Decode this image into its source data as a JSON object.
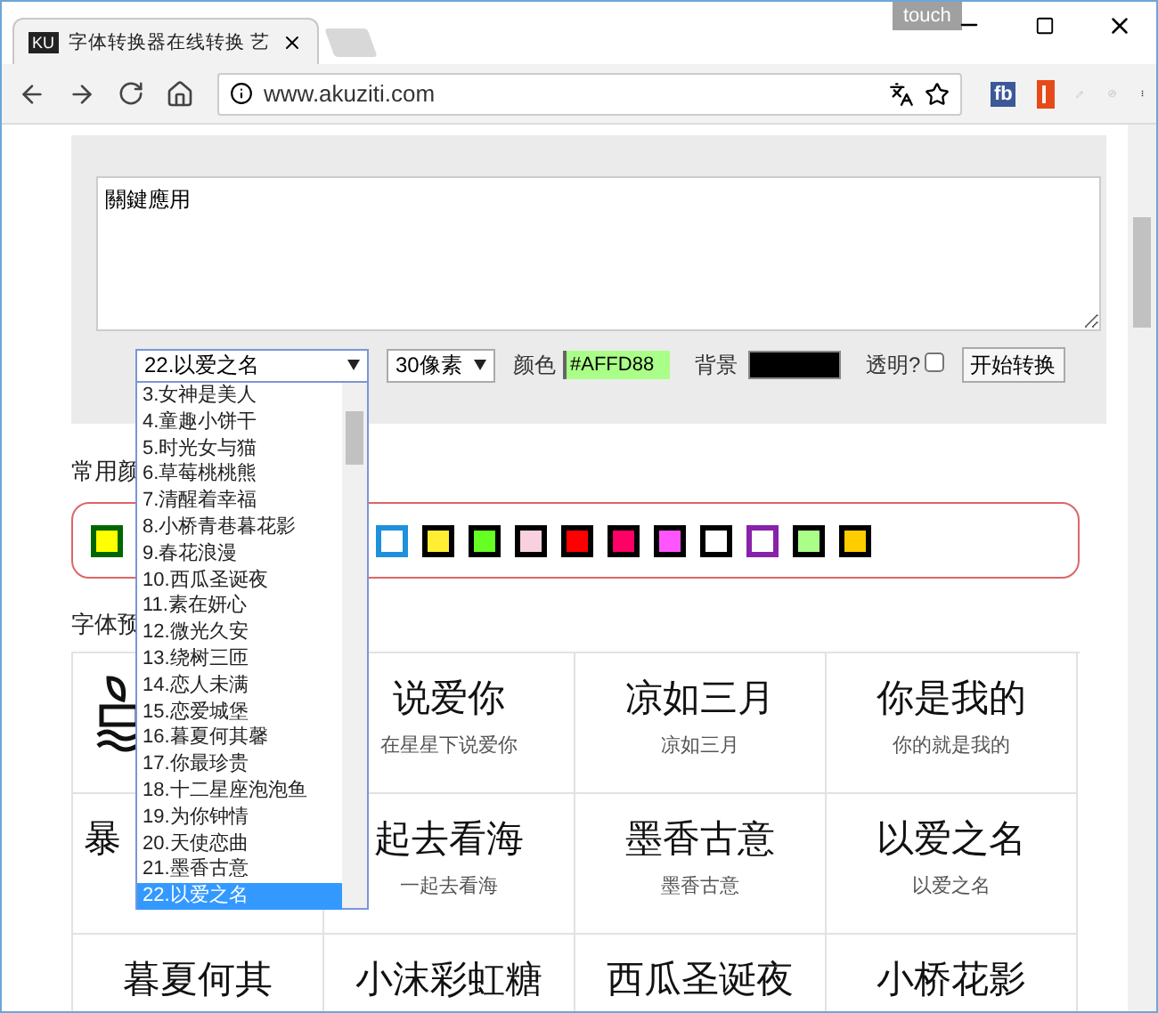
{
  "browser": {
    "tab_title": "字体转换器在线转换 艺",
    "touch_label": "touch",
    "address": "www.akuziti.com",
    "extension_label": "fb",
    "favicon_text": "KU"
  },
  "form": {
    "text_value": "關鍵應用",
    "font_select": {
      "value": "22.以爱之名",
      "expanded": true,
      "options": [
        {
          "label": "3.女神是美人",
          "selected": false
        },
        {
          "label": "4.童趣小饼干",
          "selected": false
        },
        {
          "label": "5.时光女与猫",
          "selected": false
        },
        {
          "label": "6.草莓桃桃熊",
          "selected": false
        },
        {
          "label": "7.清醒着幸福",
          "selected": false
        },
        {
          "label": "8.小桥青巷暮花影",
          "selected": false
        },
        {
          "label": "9.春花浪漫",
          "selected": false
        },
        {
          "label": "10.西瓜圣诞夜",
          "selected": false
        },
        {
          "label": "11.素在妍心",
          "selected": false
        },
        {
          "label": "12.微光久安",
          "selected": false
        },
        {
          "label": "13.绕树三匝",
          "selected": false
        },
        {
          "label": "14.恋人未满",
          "selected": false
        },
        {
          "label": "15.恋爱城堡",
          "selected": false
        },
        {
          "label": "16.暮夏何其馨",
          "selected": false
        },
        {
          "label": "17.你最珍贵",
          "selected": false
        },
        {
          "label": "18.十二星座泡泡鱼",
          "selected": false
        },
        {
          "label": "19.为你钟情",
          "selected": false
        },
        {
          "label": "20.天使恋曲",
          "selected": false
        },
        {
          "label": "21.墨香古意",
          "selected": false
        },
        {
          "label": "22.以爱之名",
          "selected": true
        }
      ]
    },
    "size_select": {
      "value": "30像素"
    },
    "color_label": "颜色",
    "color_field": {
      "value": "#AFFD88",
      "color": "#aaff88"
    },
    "background_label": "背景",
    "background_field": {
      "color": "#000000"
    },
    "transparent_label": "透明?",
    "transparent_checked": false,
    "submit": "开始转换"
  },
  "colors_title": "常用颜",
  "swatches": [
    {
      "color": "#ffff00",
      "frame": {
        "color": "#006600"
      }
    },
    {
      "color": "#ffffff",
      "frame": {
        "color": "#1e90dd"
      }
    },
    {
      "color": "#ffee33",
      "frame": {
        "color": "#000000"
      }
    },
    {
      "color": "#66ff22",
      "frame": {
        "color": "#000000"
      }
    },
    {
      "color": "#f8d0e0",
      "frame": {
        "color": "#000000"
      }
    },
    {
      "color": "#ff0000",
      "frame": {
        "color": "#000000"
      }
    },
    {
      "color": "#ff0066",
      "frame": {
        "color": "#000000"
      }
    },
    {
      "color": "#ff55ff",
      "frame": {
        "color": "#000000"
      }
    },
    {
      "color": "#ffffff",
      "frame": {
        "color": "#000000"
      }
    },
    {
      "color": "#ffffff",
      "frame": {
        "color": "#8822aa"
      }
    },
    {
      "color": "#aaff88",
      "frame": {
        "color": "#000000"
      }
    },
    {
      "color": "#ffcc00",
      "frame": {
        "color": "#000000"
      }
    }
  ],
  "preview_title": "字体预",
  "previews": [
    [
      {
        "kind": "drawing"
      },
      {
        "kind": "full",
        "sample": "说爱你",
        "caption": "在星星下说爱你"
      },
      {
        "kind": "full",
        "sample": "凉如三月",
        "caption": "凉如三月"
      },
      {
        "kind": "full",
        "sample": "你是我的",
        "caption": "你的就是我的"
      }
    ],
    [
      {
        "kind": "left",
        "sample": "暴"
      },
      {
        "kind": "full",
        "sample": "起去看海",
        "caption": "一起去看海"
      },
      {
        "kind": "full",
        "sample": "墨香古意",
        "caption": "墨香古意"
      },
      {
        "kind": "full",
        "sample": "以爱之名",
        "caption": "以爱之名"
      }
    ],
    [
      {
        "kind": "full",
        "sample": "暮夏何其"
      },
      {
        "kind": "full",
        "sample": "小沫彩虹糖"
      },
      {
        "kind": "full",
        "sample": "西瓜圣诞夜"
      },
      {
        "kind": "full",
        "sample": "小桥花影"
      }
    ]
  ]
}
